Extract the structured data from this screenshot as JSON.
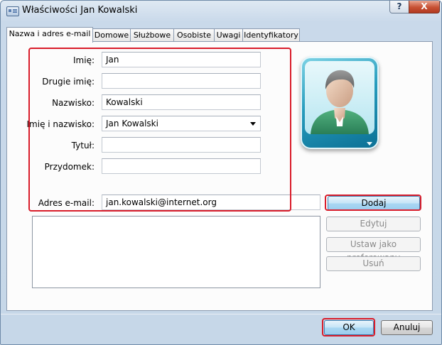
{
  "window": {
    "title": "Właściwości Jan Kowalski"
  },
  "titlebar": {
    "help_label": "?",
    "close_label": "X"
  },
  "tabs": [
    {
      "label": "Nazwa i adres e-mail",
      "active": true
    },
    {
      "label": "Domowe",
      "active": false
    },
    {
      "label": "Służbowe",
      "active": false
    },
    {
      "label": "Osobiste",
      "active": false
    },
    {
      "label": "Uwagi",
      "active": false
    },
    {
      "label": "Identyfikatory",
      "active": false
    }
  ],
  "form": {
    "first_name": {
      "label": "Imię:",
      "value": "Jan"
    },
    "middle_name": {
      "label": "Drugie imię:",
      "value": ""
    },
    "last_name": {
      "label": "Nazwisko:",
      "value": "Kowalski"
    },
    "full_name": {
      "label": "Imię i nazwisko:",
      "value": "Jan Kowalski"
    },
    "title": {
      "label": "Tytuł:",
      "value": ""
    },
    "nickname": {
      "label": "Przydomek:",
      "value": ""
    },
    "email": {
      "label": "Adres e-mail:",
      "value": "jan.kowalski@internet.org"
    }
  },
  "email_buttons": {
    "add": "Dodaj",
    "edit": "Edytuj",
    "set_preferred": "Ustaw jako preferowany",
    "remove": "Usuń"
  },
  "dialog_buttons": {
    "ok": "OK",
    "cancel": "Anuluj"
  },
  "colors": {
    "highlight": "#d91c2a",
    "titlebar": "#c9d9ea",
    "avatar_frame": "#279cbd",
    "avatar_shirt": "#3f9a6e"
  }
}
